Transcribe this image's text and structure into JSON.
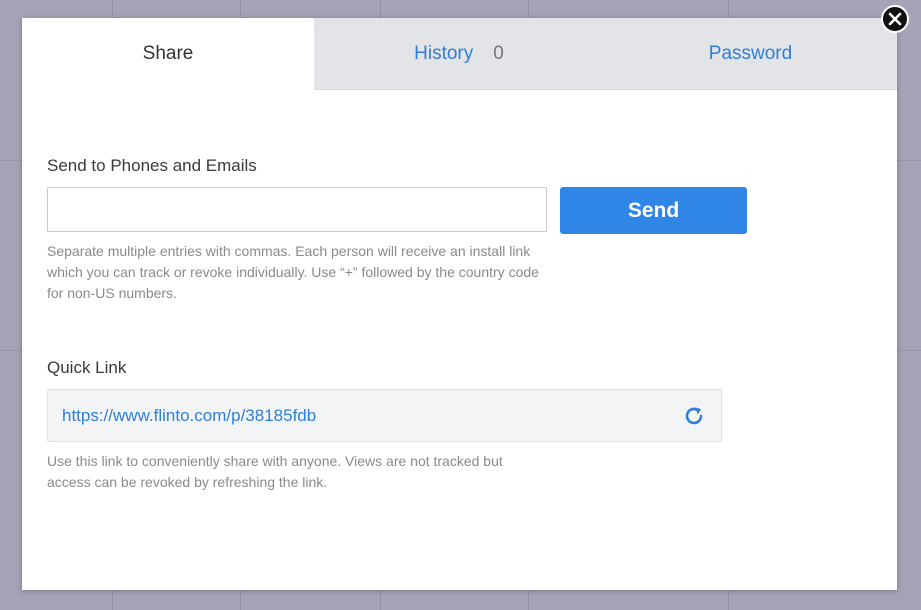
{
  "modal": {
    "tabs": [
      {
        "label": "Share"
      },
      {
        "label": "History",
        "count": "0"
      },
      {
        "label": "Password"
      }
    ],
    "send_section": {
      "label": "Send to Phones and Emails",
      "input_value": "",
      "input_placeholder": "",
      "send_button": "Send",
      "hint": "Separate multiple entries with commas. Each person will receive an install link which you can track or revoke individually. Use “+” followed by the country code for non-US numbers."
    },
    "quick_link_section": {
      "label": "Quick Link",
      "url": "https://www.flinto.com/p/38185fdb",
      "hint": "Use this link to conveniently share with anyone. Views are not tracked but access can be revoked by refreshing the link."
    }
  },
  "icons": {
    "close": "close-icon",
    "refresh": "refresh-icon"
  },
  "colors": {
    "accent": "#2f86e6",
    "link": "#2f7fd6",
    "inactive_tab_bg": "#e2e4e8",
    "overlay": "#8f8d9f"
  }
}
